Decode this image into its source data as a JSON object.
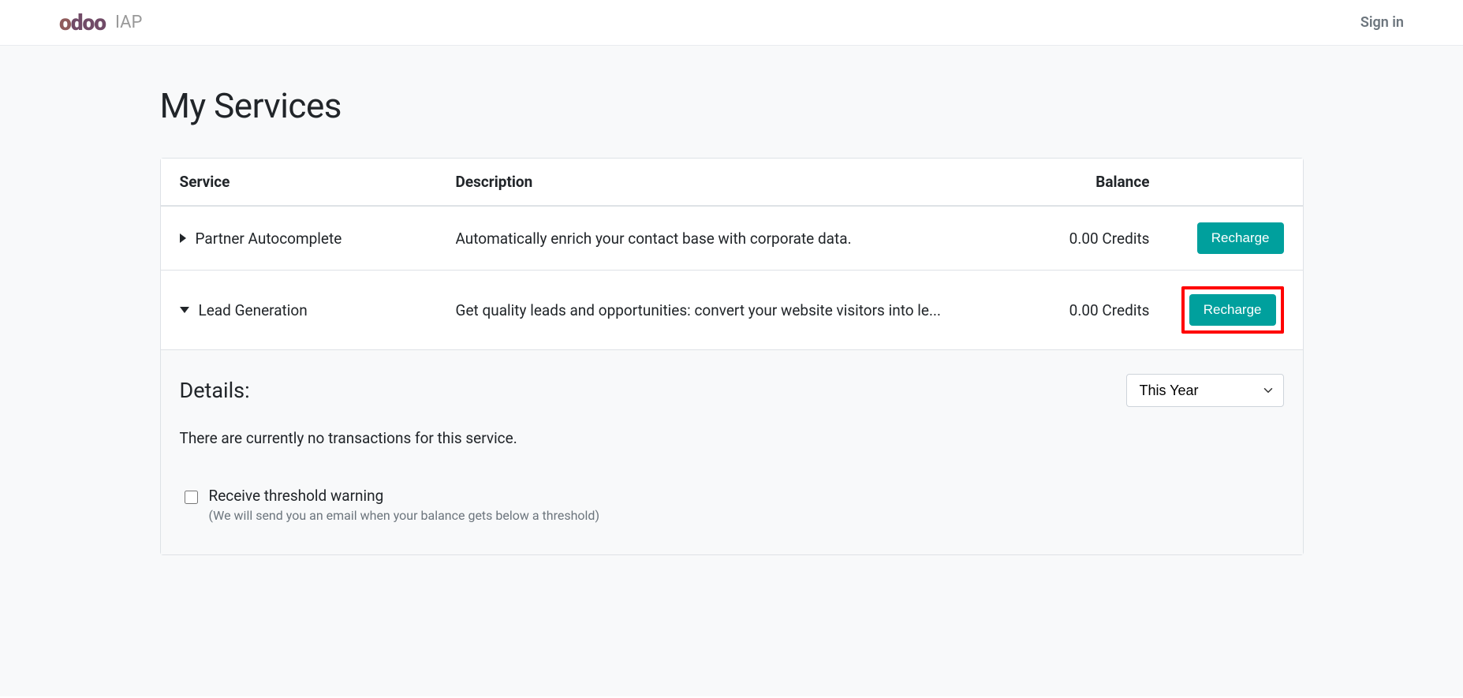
{
  "header": {
    "brand_main": "odoo",
    "brand_sub": "IAP",
    "signin_label": "Sign in"
  },
  "page": {
    "title": "My Services"
  },
  "table": {
    "headers": {
      "service": "Service",
      "description": "Description",
      "balance": "Balance"
    },
    "rows": [
      {
        "name": "Partner Autocomplete",
        "description": "Automatically enrich your contact base with corporate data.",
        "balance": "0.00 Credits",
        "action_label": "Recharge",
        "expanded": false
      },
      {
        "name": "Lead Generation",
        "description": "Get quality leads and opportunities: convert your website visitors into le...",
        "balance": "0.00 Credits",
        "action_label": "Recharge",
        "expanded": true,
        "highlighted": true
      }
    ]
  },
  "details": {
    "title": "Details:",
    "period_selected": "This Year",
    "empty_message": "There are currently no transactions for this service.",
    "threshold": {
      "checked": false,
      "label": "Receive threshold warning",
      "hint": "(We will send you an email when your balance gets below a threshold)"
    }
  }
}
